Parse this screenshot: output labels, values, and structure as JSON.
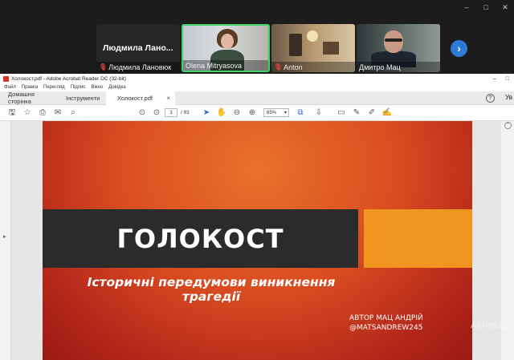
{
  "meeting": {
    "participants": [
      {
        "name": "Людмила Лановюк",
        "tile_heading": "Людмила Лано...",
        "muted": true
      },
      {
        "name": "Olena Mitryasova",
        "muted": false,
        "active_speaker": true
      },
      {
        "name": "Anton",
        "muted": true
      },
      {
        "name": "Дмитро Мац",
        "muted": false
      }
    ],
    "window_controls": [
      "–",
      "□",
      "✕"
    ],
    "next_page_icon": "chevron-right-icon"
  },
  "acrobat": {
    "window_title": "Холокост.pdf - Adobe Acrobat Reader DC (32-bit)",
    "menu": [
      "Файл",
      "Правка",
      "Перегляд",
      "Підпис",
      "Вікно",
      "Довідка"
    ],
    "tabs": {
      "home": "Домашня сторінка",
      "tools": "Інструменти",
      "document": "Холокост.pdf"
    },
    "user_initials": "Ув",
    "page": {
      "current": "1",
      "total": "/ 91"
    },
    "zoom": "65%",
    "slide": {
      "title": "ГОЛОКОСТ",
      "subtitle_line1": "Історичні передумови виникнення",
      "subtitle_line2": "трагедії",
      "author_line1": "АВТОР МАЦ АНДРІЙ",
      "author_line2": "@MATSANDREW245"
    },
    "watermark": "Активац"
  },
  "colors": {
    "active_speaker_border": "#3fd26b",
    "mic_muted": "#e0453a",
    "next_button": "#2c7bd6",
    "slide_band": "#2b2b2b",
    "slide_accent": "#f0951f",
    "slide_background": "#d94d21"
  }
}
